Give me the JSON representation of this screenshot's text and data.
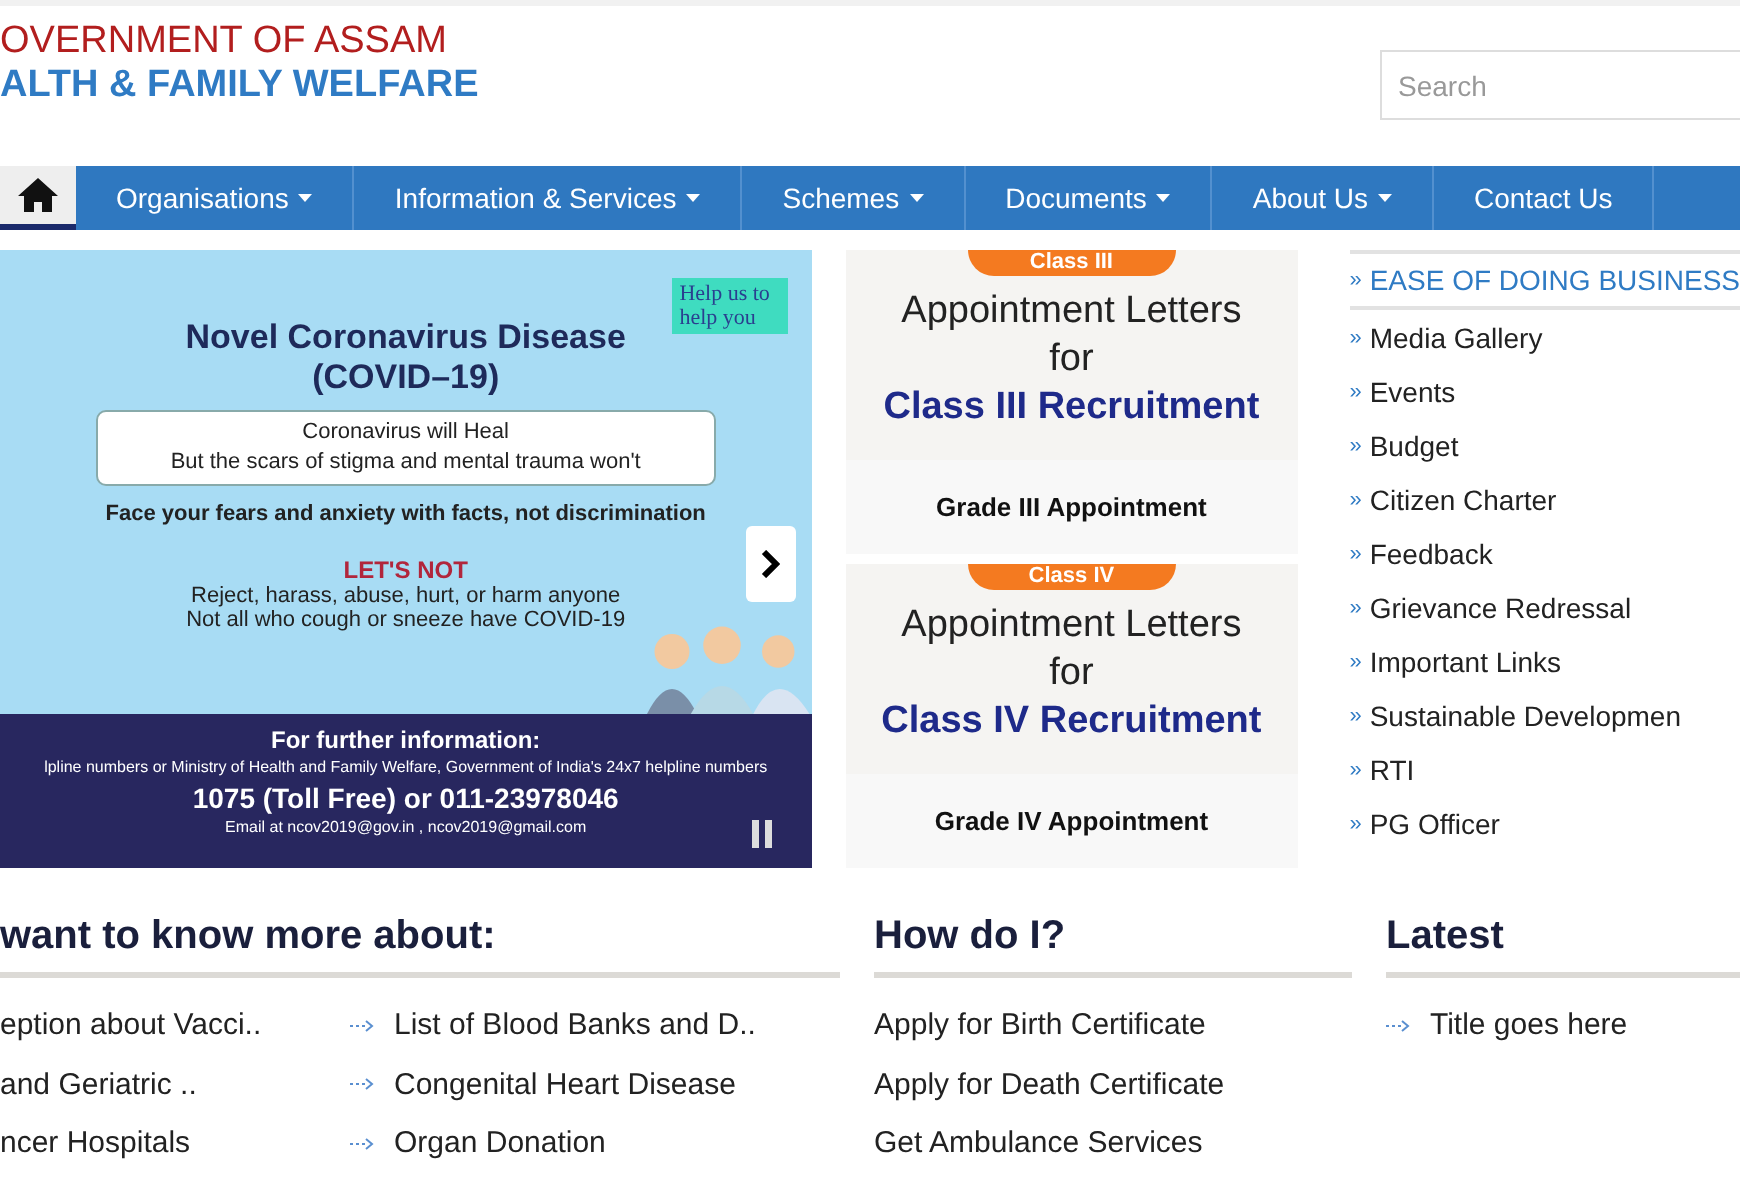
{
  "header": {
    "title_line_1": "OVERNMENT OF ASSAM",
    "title_line_2": "ALTH & FAMILY WELFARE"
  },
  "search": {
    "placeholder": "Search"
  },
  "nav": [
    {
      "kind": "home",
      "selected": true
    },
    {
      "kind": "dropdown",
      "label": "Organisations",
      "selected": false
    },
    {
      "kind": "dropdown",
      "label": "Information & Services",
      "selected": false
    },
    {
      "kind": "dropdown",
      "label": "Schemes",
      "selected": false
    },
    {
      "kind": "dropdown",
      "label": "Documents",
      "selected": false
    },
    {
      "kind": "dropdown",
      "label": "About Us",
      "selected": false
    },
    {
      "kind": "link",
      "label": "Contact Us",
      "selected": false
    }
  ],
  "banner": {
    "badge": "Help us to help you",
    "title": "Novel Coronavirus Disease",
    "subtitle": "(COVID–19)",
    "box_lines": [
      "Coronavirus will Heal",
      "But the scars of stigma and mental trauma won't"
    ],
    "tagline": "Face your fears and anxiety with facts, not discrimination",
    "lets_not": "LET'S NOT",
    "lets_not_lines": [
      "Reject, harass, abuse, hurt, or harm anyone",
      "Not all who cough or sneeze have COVID-19"
    ],
    "info_heading": "For further information:",
    "info_line": "lpline numbers or Ministry of Health and Family Welfare, Government of India's 24x7 helpline numbers",
    "phone": "1075 (Toll Free) or 011-23978046",
    "email": "Email at ncov2019@gov.in , ncov2019@gmail.com"
  },
  "cards": [
    {
      "badge": "Class III",
      "line_1": "Appointment Letters",
      "line_2": "for",
      "line_3": "Class III Recruitment",
      "caption": "Grade III Appointment"
    },
    {
      "badge": "Class IV",
      "line_1": "Appointment Letters",
      "line_2": "for",
      "line_3": "Class IV Recruitment",
      "caption": "Grade IV Appointment"
    }
  ],
  "sidebar": {
    "bullet": "»",
    "items": [
      {
        "label": "EASE OF DOING BUSINESS",
        "highlighted": true
      },
      {
        "label": "Media Gallery",
        "highlighted": false
      },
      {
        "label": "Events",
        "highlighted": false
      },
      {
        "label": "Budget",
        "highlighted": false
      },
      {
        "label": "Citizen Charter",
        "highlighted": false
      },
      {
        "label": "Feedback",
        "highlighted": false
      },
      {
        "label": "Grievance Redressal",
        "highlighted": false
      },
      {
        "label": "Important Links",
        "highlighted": false
      },
      {
        "label": "Sustainable Developmen",
        "highlighted": false
      },
      {
        "label": "RTI",
        "highlighted": false
      },
      {
        "label": "PG Officer",
        "highlighted": false
      }
    ]
  },
  "know_more": {
    "heading": "want to know more about:",
    "columns": [
      {
        "arrows": false,
        "items": [
          "eption about Vacci..",
          "and Geriatric ..",
          "ncer Hospitals"
        ]
      },
      {
        "arrows": true,
        "items": [
          "List of Blood Banks and D..",
          "Congenital Heart Disease",
          "Organ Donation"
        ]
      }
    ]
  },
  "how_do_i": {
    "heading": "How do I?",
    "items": [
      "Apply for Birth Certificate",
      "Apply for Death Certificate",
      "Get Ambulance Services"
    ]
  },
  "latest": {
    "heading": "Latest",
    "items": [
      "Title goes here"
    ]
  }
}
